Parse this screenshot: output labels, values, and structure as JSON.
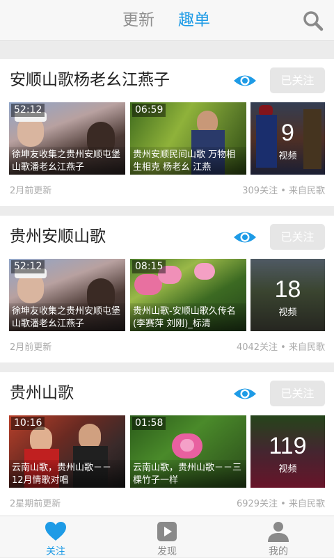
{
  "header": {
    "tabs": [
      {
        "label": "更新",
        "active": false
      },
      {
        "label": "趣单",
        "active": true
      }
    ],
    "search_icon": "search-icon",
    "accent": "#1e9be6"
  },
  "sections": [
    {
      "title": "安顺山歌杨老幺江燕子",
      "follow_label": "已关注",
      "videos": [
        {
          "duration": "52:12",
          "label": "徐坤友收集之贵州安顺屯堡山歌潘老幺江燕子"
        },
        {
          "duration": "06:59",
          "label": "贵州安顺民间山歌 万物相生相克 杨老幺 江燕"
        }
      ],
      "count": "9",
      "count_unit": "视频",
      "updated": "2月前更新",
      "stats": "309关注 • 来自民歌"
    },
    {
      "title": "贵州安顺山歌",
      "follow_label": "已关注",
      "videos": [
        {
          "duration": "52:12",
          "label": "徐坤友收集之贵州安顺屯堡山歌潘老幺江燕子"
        },
        {
          "duration": "08:15",
          "label": "贵州山歌-安顺山歌久传名(李赛萍 刘刚)_标清"
        }
      ],
      "count": "18",
      "count_unit": "视频",
      "updated": "2月前更新",
      "stats": "4042关注 • 来自民歌"
    },
    {
      "title": "贵州山歌",
      "follow_label": "已关注",
      "videos": [
        {
          "duration": "10:16",
          "label": "云南山歌，贵州山歌－－12月情歌对唱"
        },
        {
          "duration": "01:58",
          "label": "云南山歌，贵州山歌－－三棵竹子一样"
        }
      ],
      "count": "119",
      "count_unit": "视频",
      "updated": "2星期前更新",
      "stats": "6929关注 • 来自民歌"
    }
  ],
  "bottom_nav": [
    {
      "label": "关注",
      "icon": "heart-icon",
      "active": true
    },
    {
      "label": "发现",
      "icon": "play-icon",
      "active": false
    },
    {
      "label": "我的",
      "icon": "user-icon",
      "active": false
    }
  ]
}
